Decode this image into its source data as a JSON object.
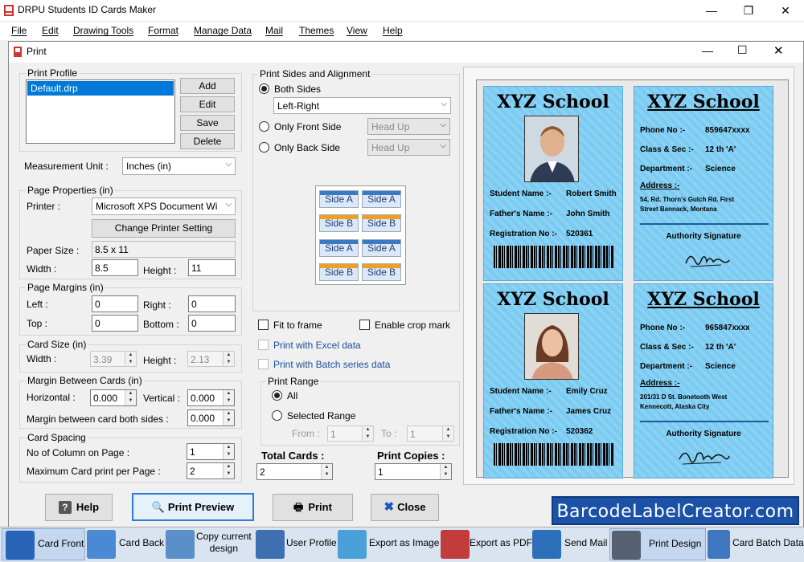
{
  "app": {
    "title": "DRPU Students ID Cards Maker",
    "menu": [
      "File",
      "Edit",
      "Drawing Tools",
      "Format",
      "Manage Data",
      "Mail",
      "Themes",
      "View",
      "Help"
    ]
  },
  "dialog": {
    "title": "Print",
    "print_profile": {
      "label": "Print Profile",
      "items": [
        "Default.drp"
      ],
      "buttons": {
        "add": "Add",
        "edit": "Edit",
        "save": "Save",
        "delete": "Delete"
      }
    },
    "measurement": {
      "label": "Measurement Unit :",
      "value": "Inches (in)"
    },
    "page_properties": {
      "label": "Page Properties (in)",
      "printer_label": "Printer :",
      "printer_value": "Microsoft XPS Document Wi",
      "change_printer": "Change Printer Setting",
      "paper_size_label": "Paper Size :",
      "paper_size_value": "8.5 x 11",
      "width_label": "Width :",
      "width_value": "8.5",
      "height_label": "Height :",
      "height_value": "11"
    },
    "page_margins": {
      "label": "Page Margins (in)",
      "left_label": "Left :",
      "left_value": "0",
      "right_label": "Right :",
      "right_value": "0",
      "top_label": "Top :",
      "top_value": "0",
      "bottom_label": "Bottom :",
      "bottom_value": "0"
    },
    "card_size": {
      "label": "Card Size (in)",
      "width_label": "Width :",
      "width_value": "3.39",
      "height_label": "Height :",
      "height_value": "2.13"
    },
    "margin_between": {
      "label": "Margin Between Cards (in)",
      "horizontal_label": "Horizontal :",
      "horizontal_value": "0.000",
      "vertical_label": "Vertical :",
      "vertical_value": "0.000",
      "both_label": "Margin between card both sides :",
      "both_value": "0.000"
    },
    "card_spacing": {
      "label": "Card Spacing",
      "columns_label": "No of Column on Page :",
      "columns_value": "1",
      "max_label": "Maximum Card print per Page :",
      "max_value": "2"
    },
    "sides": {
      "label": "Print Sides and Alignment",
      "both": "Both Sides",
      "both_option": "Left-Right",
      "front": "Only Front Side",
      "front_option": "Head Up",
      "back": "Only Back Side",
      "back_option": "Head Up",
      "tiles": [
        "Side A",
        "Side A",
        "Side B",
        "Side B",
        "Side A",
        "Side A",
        "Side B",
        "Side B"
      ]
    },
    "options": {
      "fit_to_frame": "Fit to frame",
      "crop_mark": "Enable crop mark",
      "excel": "Print with Excel data",
      "batch": "Print with Batch series data"
    },
    "print_range": {
      "label": "Print Range",
      "all": "All",
      "selected": "Selected Range",
      "from_label": "From :",
      "from_value": "1",
      "to_label": "To :",
      "to_value": "1"
    },
    "totals": {
      "total_label": "Total Cards :",
      "total_value": "2",
      "copies_label": "Print Copies :",
      "copies_value": "1"
    },
    "buttons": {
      "help": "Help",
      "preview": "Print Preview",
      "print": "Print",
      "close": "Close"
    }
  },
  "cards": [
    {
      "front": {
        "school": "XYZ School",
        "student_label": "Student Name :-",
        "student": "Robert Smith",
        "father_label": "Father's Name :-",
        "father": "John Smith",
        "reg_label": "Registration No :-",
        "reg": "520361"
      },
      "back": {
        "school": "XYZ School",
        "phone_label": "Phone No :-",
        "phone": "859647xxxx",
        "class_label": "Class & Sec :-",
        "class": "12 th 'A'",
        "dept_label": "Department :-",
        "dept": "Science",
        "address_label": "Address :-",
        "address1": "54, Rd. Thorn's Gulch Rd. First",
        "address2": "Street Bannack, Montana",
        "signature_label": "Authority Signature"
      }
    },
    {
      "front": {
        "school": "XYZ School",
        "student_label": "Student Name :-",
        "student": "Emily Cruz",
        "father_label": "Father's Name :-",
        "father": "James Cruz",
        "reg_label": "Registration No :-",
        "reg": "520362"
      },
      "back": {
        "school": "XYZ School",
        "phone_label": "Phone No :-",
        "phone": "965847xxxx",
        "class_label": "Class & Sec :-",
        "class": "12 th 'A'",
        "dept_label": "Department :-",
        "dept": "Science",
        "address_label": "Address :-",
        "address1": "201/31 D St. Bonetooth West",
        "address2": "Kennecott, Alaska City",
        "signature_label": "Authority Signature"
      }
    }
  ],
  "brand": "BarcodeLabelCreator.com",
  "toolbar": {
    "card_front": "Card Front",
    "card_back": "Card Back",
    "copy_design_1": "Copy current",
    "copy_design_2": "design",
    "user_profile": "User Profile",
    "export_image": "Export as Image",
    "export_pdf": "Export as PDF",
    "send_mail": "Send Mail",
    "print_design": "Print Design",
    "card_batch": "Card Batch Data"
  },
  "colors": {
    "card_bg": "#7ecef4",
    "brand_bg": "#1b52a8",
    "selection": "#0078d7"
  }
}
